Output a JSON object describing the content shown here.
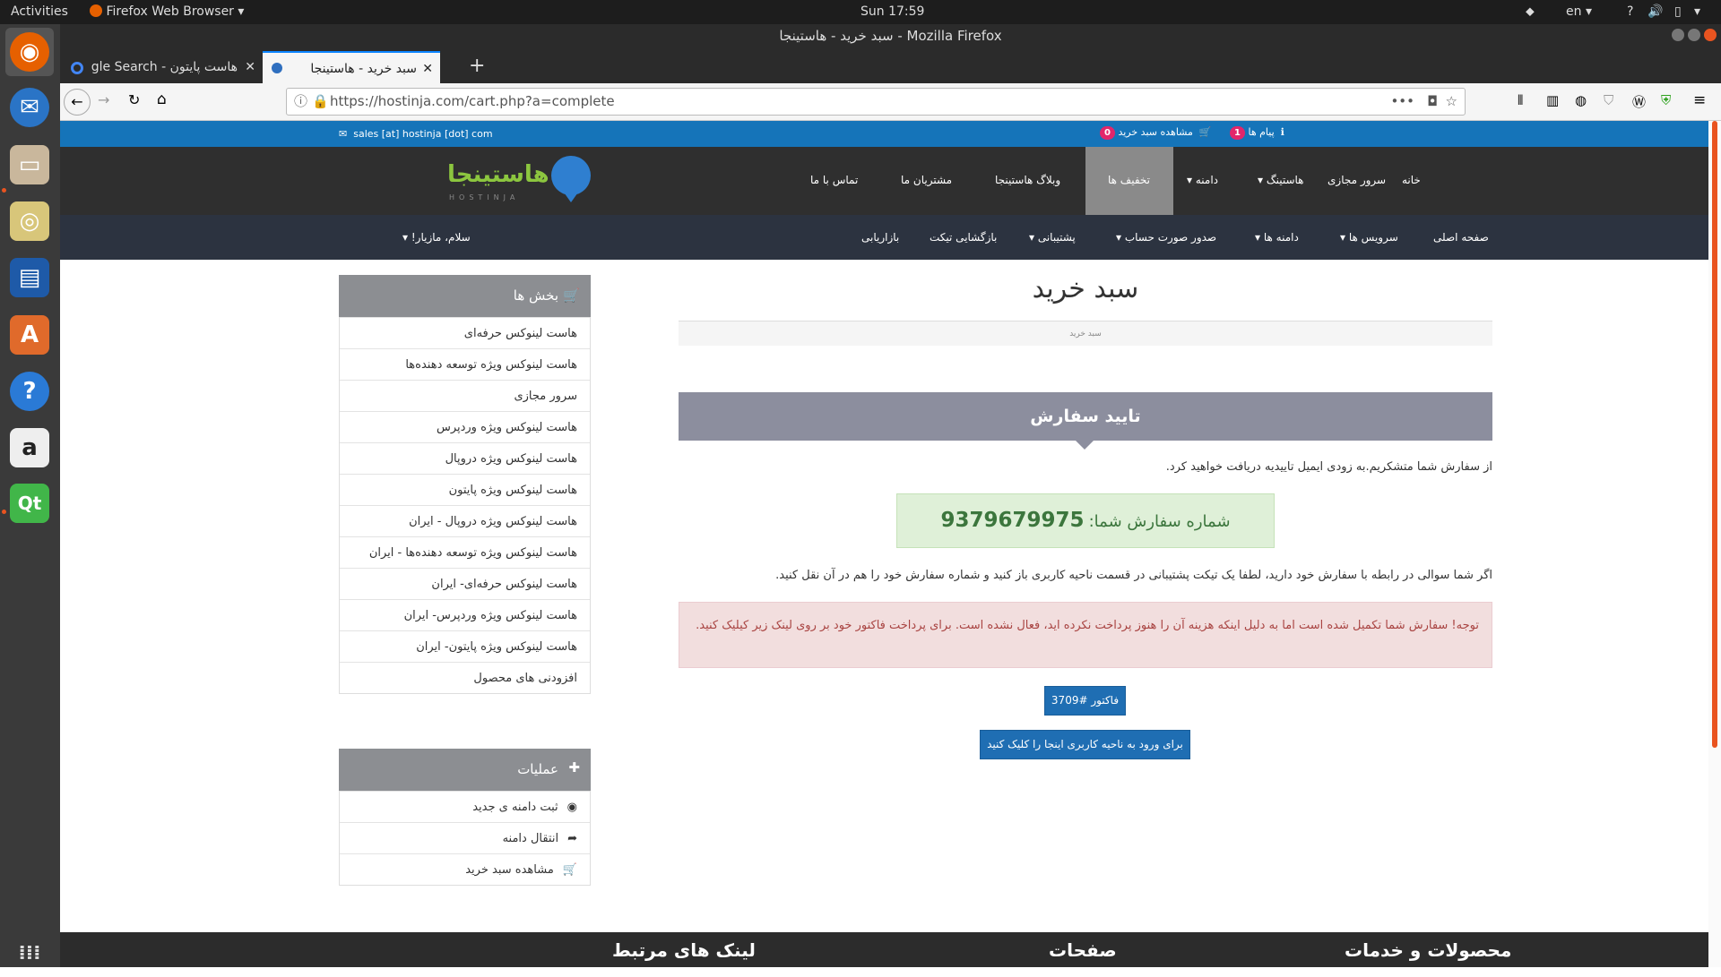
{
  "system": {
    "activities": "Activities",
    "app_menu": "Firefox Web Browser",
    "clock": "Sun 17:59",
    "lang": "en",
    "help": "?"
  },
  "window": {
    "title": "سبد خرید - هاستینجا - Mozilla Firefox"
  },
  "tabs": [
    {
      "label": "هاست پایتون - Google Search"
    },
    {
      "label": "سبد خرید - هاستینجا"
    }
  ],
  "url": "https://hostinja.com/cart.php?a=complete",
  "infobar": {
    "email": "sales [at] hostinja [dot] com",
    "messages_label": "پیام ها",
    "messages_count": "1",
    "cart_label": "مشاهده سبد خرید",
    "cart_count": "0"
  },
  "logo": {
    "fa": "هاستینجا",
    "en": "HOSTINJA"
  },
  "main_nav": [
    {
      "label": "خانه"
    },
    {
      "label": "سرور مجازی"
    },
    {
      "label": "هاستینگ"
    },
    {
      "label": "دامنه"
    },
    {
      "label": "تخفیف ها"
    },
    {
      "label": "وبلاگ هاستینجا"
    },
    {
      "label": "مشتریان ما"
    },
    {
      "label": "تماس با ما"
    }
  ],
  "sub_nav": [
    {
      "label": "صفحه اصلی"
    },
    {
      "label": "سرویس ها"
    },
    {
      "label": "دامنه ها"
    },
    {
      "label": "صدور صورت حساب"
    },
    {
      "label": "پشتیبانی"
    },
    {
      "label": "بازگشایی تیکت"
    },
    {
      "label": "بازاریابی"
    }
  ],
  "greeting": "سلام، مازیار!",
  "sidebar": {
    "categories_title": "بخش ها",
    "categories": [
      "هاست لینوکس حرفه‌ای",
      "هاست لینوکس ویژه توسعه دهنده‌ها",
      "سرور مجازی",
      "هاست لینوکس ویژه وردپرس",
      "هاست لینوکس ویژه دروپال",
      "هاست لینوکس ویژه پایتون",
      "هاست لینوکس ویژه دروپال - ایران",
      "هاست لینوکس ویژه توسعه دهنده‌ها - ایران",
      "هاست لینوکس حرفه‌ای- ایران",
      "هاست لینوکس ویژه وردپرس- ایران",
      "هاست لینوکس ویژه پایتون- ایران",
      "افزودنی های محصول"
    ],
    "actions_title": "عملیات",
    "actions": [
      {
        "label": "ثبت دامنه ی جدید",
        "icon": "globe-icon"
      },
      {
        "label": "انتقال دامنه",
        "icon": "share-icon"
      },
      {
        "label": "مشاهده سبد خرید",
        "icon": "cart-icon"
      }
    ]
  },
  "content": {
    "page_title": "سبد خرید",
    "breadcrumb": "سبد خرید",
    "confirm_header": "تایید سفارش",
    "thanks": "از سفارش شما متشکریم.به زودی ایمیل تاییدیه دریافت خواهید کرد.",
    "order_label": "شماره سفارش شما:",
    "order_number": "9379679975",
    "question": "اگر شما سوالی در رابطه با سفارش خود دارید، لطفا یک تیکت پشتیبانی در قسمت ناحیه کاربری باز کنید و شماره سفارش خود را هم در آن نقل کنید.",
    "warning": "توجه! سفارش شما تکمیل شده است اما به دلیل اینکه هزینه آن را هنوز پرداخت نکرده اید، فعال نشده است. برای پرداخت فاکتور خود بر روی لینک زیر کیلیک کنید.",
    "invoice_button": "فاکتور #3709",
    "client_area_button": "برای ورود به ناحیه کاربری اینجا را کلیک کنید"
  },
  "footer": {
    "col1": "محصولات و خدمات",
    "col2": "صفحات",
    "col3": "لینک های مرتبط"
  },
  "colors": {
    "brand_blue": "#1574b9",
    "nav_dark": "#2f2f2f",
    "alert_red": "#a94442",
    "success_green": "#3c763d"
  }
}
